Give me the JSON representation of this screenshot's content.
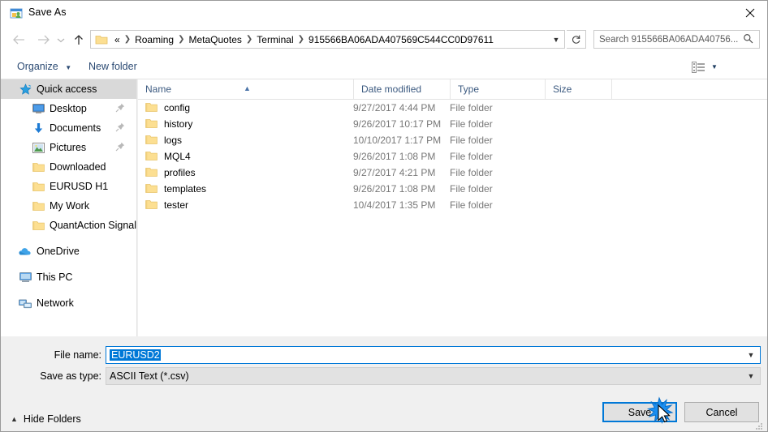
{
  "window": {
    "title": "Save As",
    "title_icon": "save-as-icon",
    "close_icon": "close-icon"
  },
  "navigation": {
    "back_icon": "back-arrow-icon",
    "forward_icon": "forward-arrow-icon",
    "recent_icon": "chevron-down-icon",
    "up_icon": "up-arrow-icon",
    "breadcrumbs": [
      "«",
      "Roaming",
      "MetaQuotes",
      "Terminal",
      "915566BA06ADA407569C544CC0D97611"
    ],
    "address_caret": "chevron-down-icon",
    "refresh_icon": "refresh-icon",
    "search_placeholder": "Search 915566BA06ADA40756...",
    "search_icon": "search-icon"
  },
  "commandbar": {
    "organize_label": "Organize",
    "organize_caret": "caret-down-icon",
    "new_folder_label": "New folder",
    "view_icon": "view-layout-icon",
    "view_caret": "chevron-down-icon",
    "help_icon": "help-icon"
  },
  "sidebar": {
    "items": [
      {
        "label": "Quick access",
        "icon": "star-icon",
        "level": 0,
        "selected": true,
        "pinned": false
      },
      {
        "label": "Desktop",
        "icon": "monitor-icon",
        "level": 1,
        "selected": false,
        "pinned": true
      },
      {
        "label": "Documents",
        "icon": "download-arrow-icon",
        "level": 1,
        "selected": false,
        "pinned": true
      },
      {
        "label": "Pictures",
        "icon": "picture-icon",
        "level": 1,
        "selected": false,
        "pinned": true
      },
      {
        "label": "Downloaded",
        "icon": "folder-icon",
        "level": 1,
        "selected": false,
        "pinned": false
      },
      {
        "label": "EURUSD H1",
        "icon": "folder-icon",
        "level": 1,
        "selected": false,
        "pinned": false
      },
      {
        "label": "My Work",
        "icon": "folder-icon",
        "level": 1,
        "selected": false,
        "pinned": false
      },
      {
        "label": "QuantAction Signal",
        "icon": "folder-icon",
        "level": 1,
        "selected": false,
        "pinned": false
      },
      {
        "label": "OneDrive",
        "icon": "cloud-icon",
        "level": 0,
        "selected": false,
        "pinned": false,
        "gap_before": true
      },
      {
        "label": "This PC",
        "icon": "computer-icon",
        "level": 0,
        "selected": false,
        "pinned": false,
        "gap_before": true
      },
      {
        "label": "Network",
        "icon": "network-icon",
        "level": 0,
        "selected": false,
        "pinned": false,
        "gap_before": true
      }
    ]
  },
  "filelist": {
    "columns": [
      "Name",
      "Date modified",
      "Type",
      "Size"
    ],
    "sort_column": "Name",
    "sort_caret": "caret-up-icon",
    "rows": [
      {
        "name": "config",
        "date": "9/27/2017 4:44 PM",
        "type": "File folder",
        "size": ""
      },
      {
        "name": "history",
        "date": "9/26/2017 10:17 PM",
        "type": "File folder",
        "size": ""
      },
      {
        "name": "logs",
        "date": "10/10/2017 1:17 PM",
        "type": "File folder",
        "size": ""
      },
      {
        "name": "MQL4",
        "date": "9/26/2017 1:08 PM",
        "type": "File folder",
        "size": ""
      },
      {
        "name": "profiles",
        "date": "9/27/2017 4:21 PM",
        "type": "File folder",
        "size": ""
      },
      {
        "name": "templates",
        "date": "9/26/2017 1:08 PM",
        "type": "File folder",
        "size": ""
      },
      {
        "name": "tester",
        "date": "10/4/2017 1:35 PM",
        "type": "File folder",
        "size": ""
      }
    ]
  },
  "form": {
    "filename_label": "File name:",
    "filename_value": "EURUSD2",
    "filename_selected": true,
    "savetype_label": "Save as type:",
    "savetype_value": "ASCII Text (*.csv)",
    "combo_caret": "chevron-down-icon"
  },
  "footer": {
    "hide_folders_label": "Hide Folders",
    "hide_folders_caret": "caret-up-icon",
    "save_label": "Save",
    "cancel_label": "Cancel",
    "cursor_icon": "cursor-click-icon",
    "resize_grip_icon": "resize-grip-icon"
  },
  "colors": {
    "accent": "#0078d7",
    "folder": "#fcdf92",
    "dialog_bg": "#f0f0f0",
    "link": "#2b4a73",
    "header_text": "#3c5a80"
  }
}
